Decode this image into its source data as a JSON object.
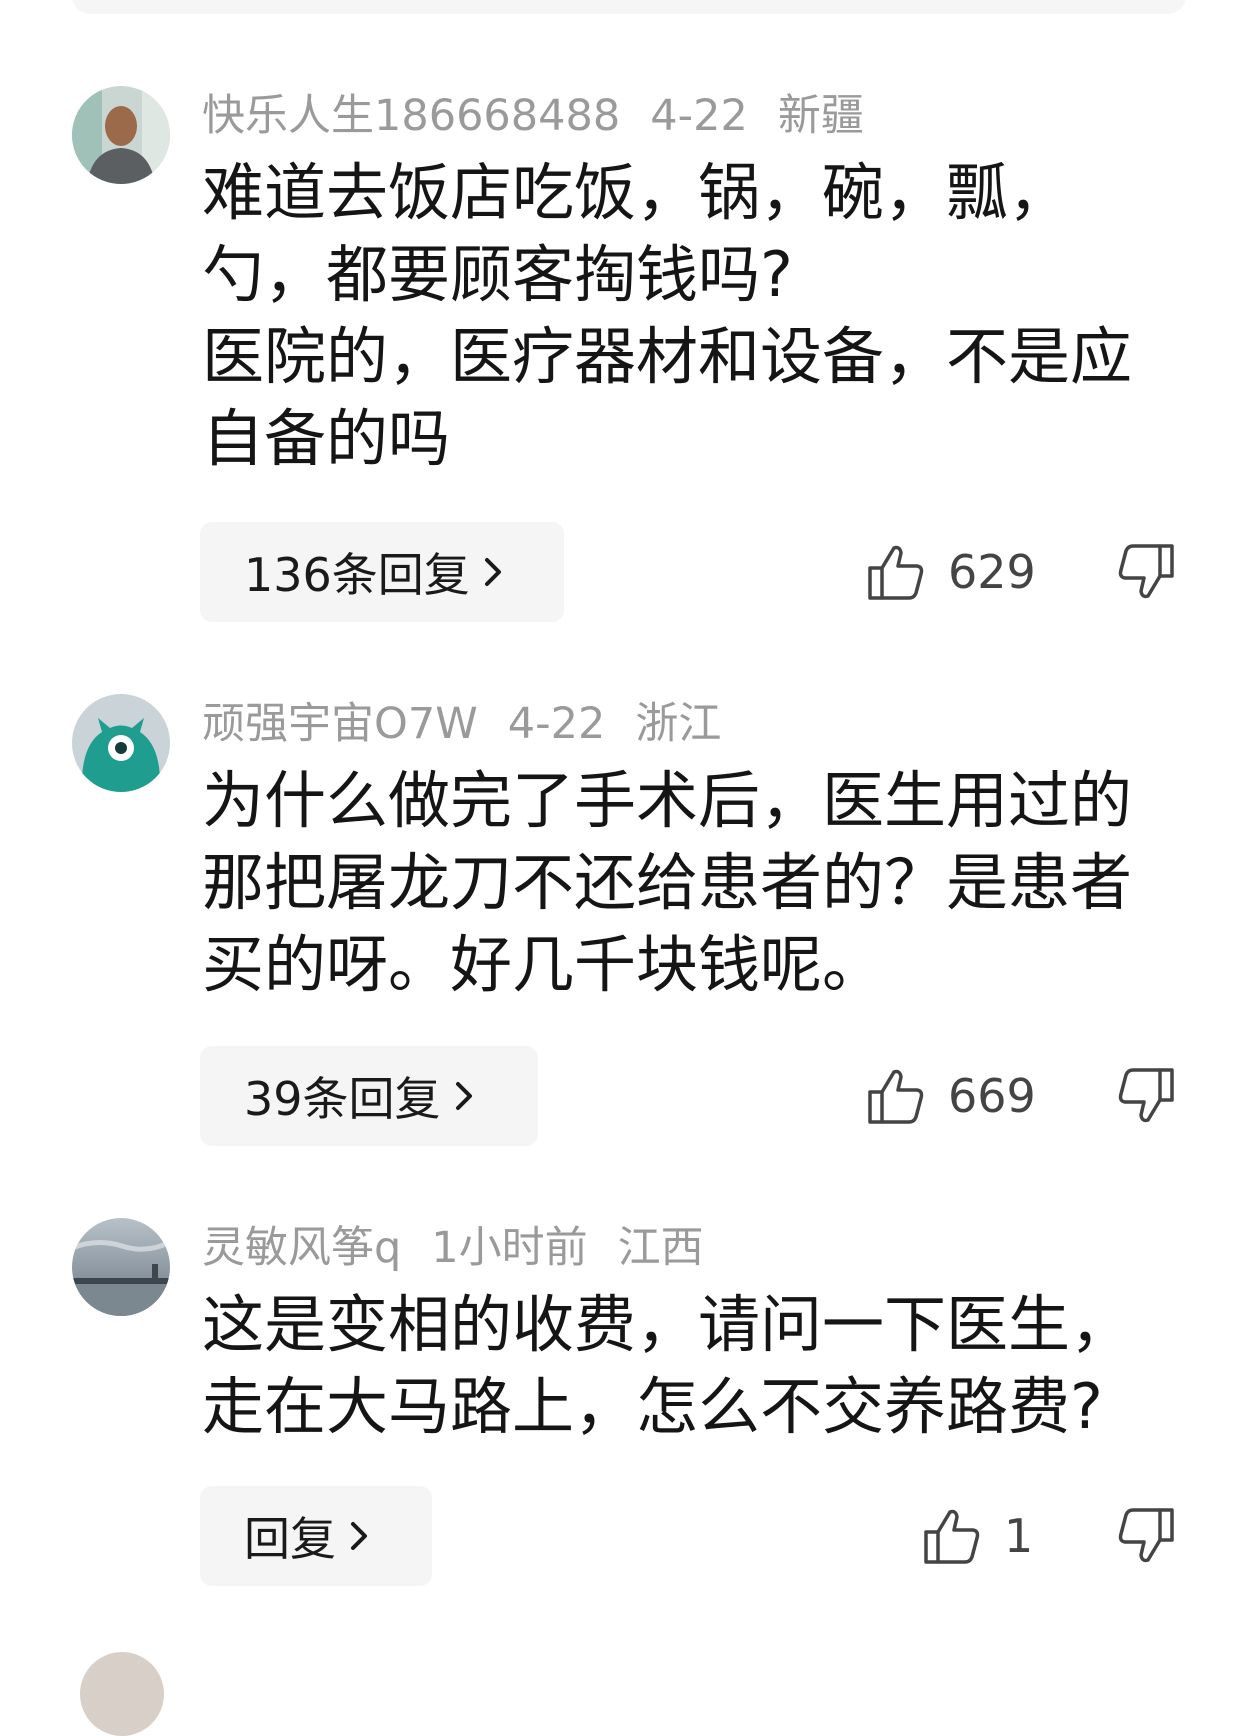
{
  "comments": [
    {
      "username": "快乐人生186668488",
      "date": "4-22",
      "location": "新疆",
      "lines": [
        "难道去饭店吃饭，锅，碗，瓢，",
        "勺，都要顾客掏钱吗?",
        "医院的，医疗器材和设备，不是应",
        "自备的吗"
      ],
      "reply_label": "136条回复",
      "likes": "629",
      "avatar_icon": "user-photo-man"
    },
    {
      "username": "顽强宇宙O7W",
      "date": "4-22",
      "location": "浙江",
      "lines": [
        "为什么做完了手术后，医生用过的",
        "那把屠龙刀不还给患者的？是患者",
        "买的呀。好几千块钱呢。"
      ],
      "reply_label": "39条回复",
      "likes": "669",
      "avatar_icon": "cartoon-monster-avatar"
    },
    {
      "username": "灵敏风筝q",
      "date": "1小时前",
      "location": "江西",
      "lines": [
        "这是变相的收费，请问一下医生，",
        "走在大马路上，怎么不交养路费?"
      ],
      "reply_label": "回复",
      "likes": "1",
      "avatar_icon": "landscape-photo-avatar"
    }
  ],
  "colors": {
    "meta_text": "#9a9a9a",
    "body_text": "#151515",
    "reply_bg": "#f5f5f5"
  }
}
